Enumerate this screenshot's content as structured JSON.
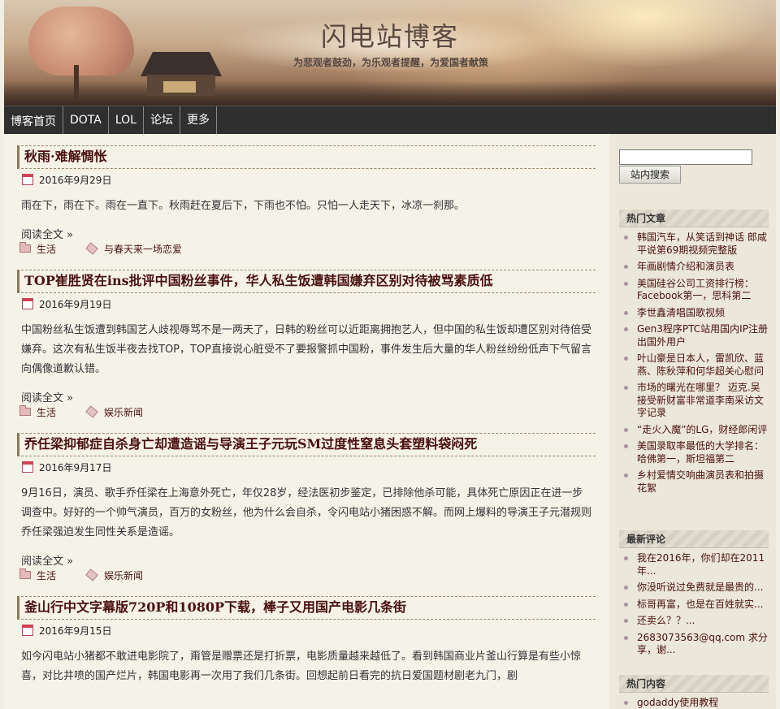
{
  "site": {
    "title": "闪电站博客",
    "tagline": "为悲观者鼓劲，为乐观者提醒，为爱国者献策"
  },
  "nav": {
    "items": [
      "博客首页",
      "DOTA",
      "LOL",
      "论坛",
      "更多"
    ]
  },
  "posts": [
    {
      "title": "秋雨·难解惆怅",
      "date": "2016年9月29日",
      "body": "雨在下，雨在下。雨在一直下。秋雨赶在夏后下，下雨也不怕。只怕一人走天下，冰凉一刹那。",
      "read_more": "阅读全文 »",
      "category": "生活",
      "tag": "与春天来一场恋爱"
    },
    {
      "title": "TOP崔胜贤在ins批评中国粉丝事件，华人私生饭遭韩国嫌弃区别对待被骂素质低",
      "date": "2016年9月19日",
      "body": "中国粉丝私生饭遭到韩国艺人歧视辱骂不是一两天了，日韩的粉丝可以近距离拥抱艺人，但中国的私生饭却遭区别对待倍受嫌弃。这次有私生饭半夜去找TOP，TOP直接说心脏受不了要报警抓中国粉，事件发生后大量的华人粉丝纷纷低声下气留言向偶像道歉认错。",
      "read_more": "阅读全文 »",
      "category": "生活",
      "tag": "娱乐新闻"
    },
    {
      "title": "乔任梁抑郁症自杀身亡却遭造谣与导演王子元玩SM过度性窒息头套塑料袋闷死",
      "date": "2016年9月17日",
      "body": "9月16日，演员、歌手乔任梁在上海意外死亡，年仅28岁，经法医初步鉴定，已排除他杀可能，具体死亡原因正在进一步调查中。好好的一个帅气演员，百万的女粉丝，他为什么会自杀，令闪电站小猪困惑不解。而网上爆料的导演王子元潜规则乔任梁强迫发生同性关系是造谣。",
      "read_more": "阅读全文 »",
      "category": "生活",
      "tag": "娱乐新闻"
    },
    {
      "title": "釜山行中文字幕版720P和1080P下载，棒子又用国产电影几条街",
      "date": "2016年9月15日",
      "body": "如今闪电站小猪都不敢进电影院了，甭管是赠票还是打折票，电影质量越来越低了。看到韩国商业片釜山行算是有些小惊喜，对比井喷的国产烂片，韩国电影再一次用了我们几条街。回想起前日看完的抗日爱国题材剧老九门，剧"
    }
  ],
  "sidebar": {
    "search_button": "站内搜索",
    "hot_articles": {
      "title": "热门文章",
      "items": [
        "韩国汽车，从笑话到神话 郎咸平说第69期视频完整版",
        "年画剧情介绍和演员表",
        "美国硅谷公司工资排行榜：Facebook第一，思科第二",
        "李世鑫清唱国歌视频",
        "Gen3程序PTC站用国内IP注册出国外用户",
        "叶山豪是日本人，雷凯欣、蓝燕、陈秋萍和何华超关心慰问",
        "市场的曙光在哪里？ 迈克.吴接受新财富非常道李南采访文字记录",
        "“走火入魔”的LG，财经郎闲评",
        "美国录取率最低的大学排名：哈佛第一，斯坦福第二",
        "乡村爱情交响曲演员表和拍摄花絮"
      ]
    },
    "latest_comments": {
      "title": "最新评论",
      "items": [
        "我在2016年，你们却在2011年...",
        "你没听说过免费就是最贵的...",
        "标哥再富，也是在百姓就实...",
        "还卖么？？...",
        "2683073563@qq.com 求分享，谢..."
      ]
    },
    "hot_content": {
      "title": "热门内容",
      "items": [
        "godaddy使用教程"
      ]
    }
  },
  "colors": {
    "nav_bg": "#2f2f2f",
    "title_color": "#4a1010",
    "page_bg": "#f5f2e8"
  }
}
